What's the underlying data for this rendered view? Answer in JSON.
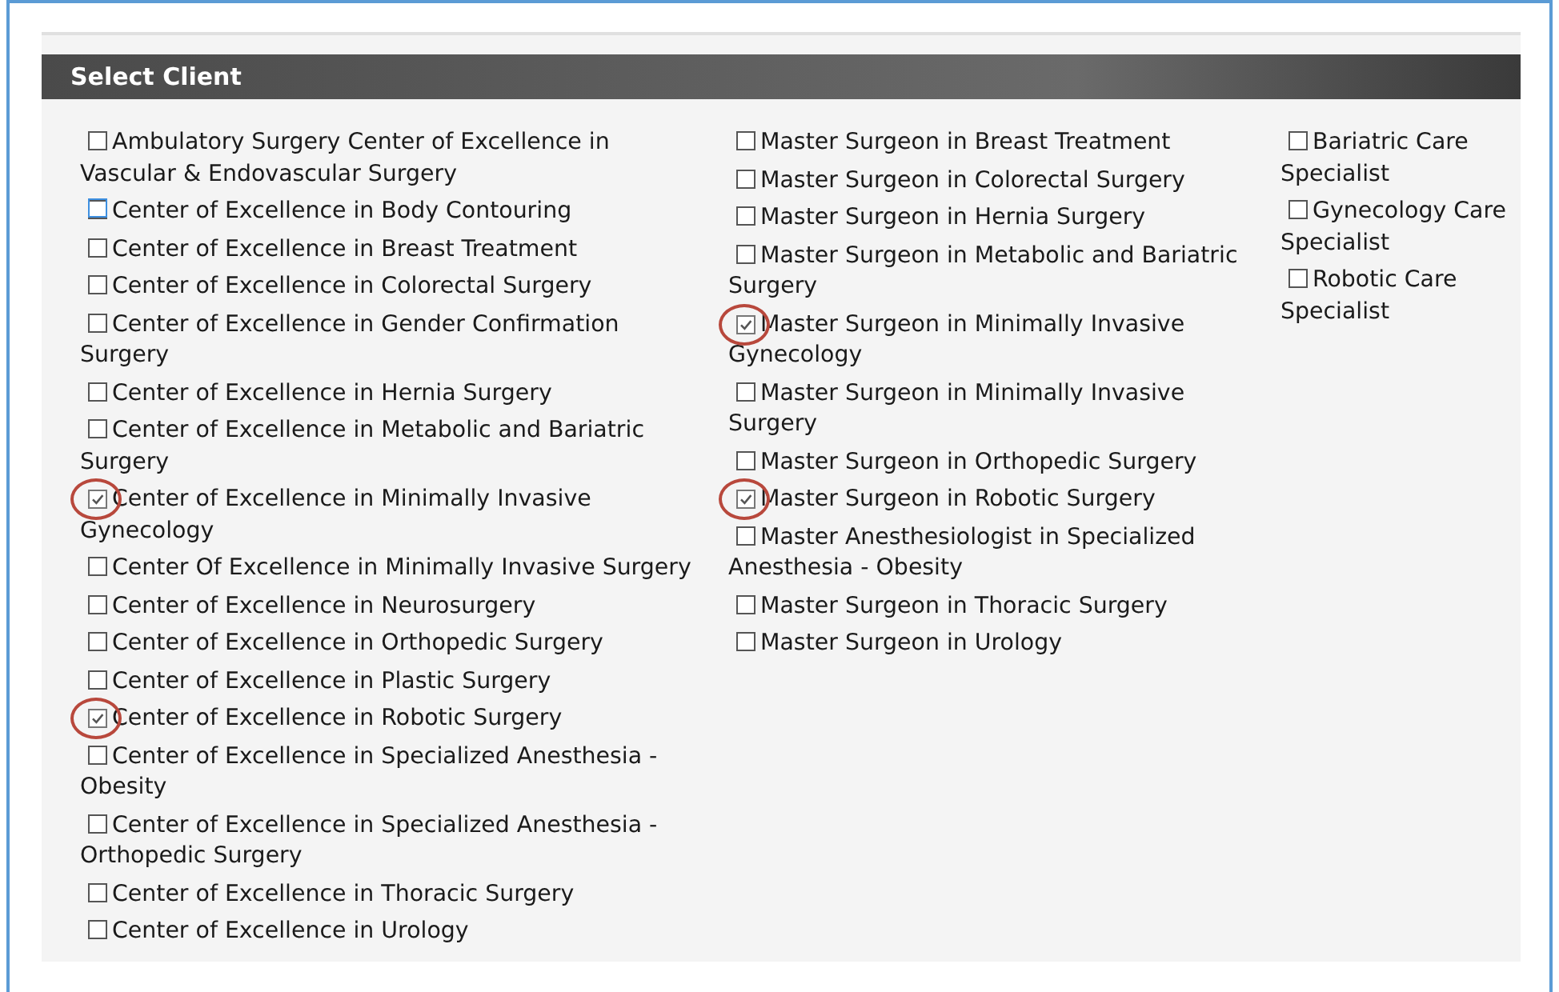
{
  "panel": {
    "title": "Select Client"
  },
  "columns": [
    {
      "items": [
        {
          "label": "Ambulatory Surgery Center of Excellence in Vascular & Endovascular Surgery",
          "checked": false,
          "focused": false,
          "circled": false
        },
        {
          "label": "Center of Excellence in Body Contouring",
          "checked": false,
          "focused": true,
          "circled": false
        },
        {
          "label": "Center of Excellence in Breast Treatment",
          "checked": false,
          "focused": false,
          "circled": false
        },
        {
          "label": "Center of Excellence in Colorectal Surgery",
          "checked": false,
          "focused": false,
          "circled": false
        },
        {
          "label": "Center of Excellence in Gender Confirmation Surgery",
          "checked": false,
          "focused": false,
          "circled": false
        },
        {
          "label": "Center of Excellence in Hernia Surgery",
          "checked": false,
          "focused": false,
          "circled": false
        },
        {
          "label": "Center of Excellence in Metabolic and Bariatric Surgery",
          "checked": false,
          "focused": false,
          "circled": false
        },
        {
          "label": "Center of Excellence in Minimally Invasive Gynecology",
          "checked": true,
          "focused": false,
          "circled": true
        },
        {
          "label": "Center Of Excellence in Minimally Invasive Surgery",
          "checked": false,
          "focused": false,
          "circled": false
        },
        {
          "label": "Center of Excellence in Neurosurgery",
          "checked": false,
          "focused": false,
          "circled": false
        },
        {
          "label": "Center of Excellence in Orthopedic Surgery",
          "checked": false,
          "focused": false,
          "circled": false
        },
        {
          "label": "Center of Excellence in Plastic Surgery",
          "checked": false,
          "focused": false,
          "circled": false
        },
        {
          "label": "Center of Excellence in Robotic Surgery",
          "checked": true,
          "focused": false,
          "circled": true
        },
        {
          "label": "Center of Excellence in Specialized Anesthesia - Obesity",
          "checked": false,
          "focused": false,
          "circled": false
        },
        {
          "label": "Center of Excellence in Specialized Anesthesia - Orthopedic Surgery",
          "checked": false,
          "focused": false,
          "circled": false
        },
        {
          "label": "Center of Excellence in Thoracic Surgery",
          "checked": false,
          "focused": false,
          "circled": false
        },
        {
          "label": "Center of Excellence in Urology",
          "checked": false,
          "focused": false,
          "circled": false
        }
      ]
    },
    {
      "items": [
        {
          "label": "Master Surgeon in Breast Treatment",
          "checked": false,
          "focused": false,
          "circled": false
        },
        {
          "label": "Master Surgeon in Colorectal Surgery",
          "checked": false,
          "focused": false,
          "circled": false
        },
        {
          "label": "Master Surgeon in Hernia Surgery",
          "checked": false,
          "focused": false,
          "circled": false
        },
        {
          "label": "Master Surgeon in Metabolic and Bariatric Surgery",
          "checked": false,
          "focused": false,
          "circled": false
        },
        {
          "label": "Master Surgeon in Minimally Invasive Gynecology",
          "checked": true,
          "focused": false,
          "circled": true
        },
        {
          "label": "Master Surgeon in Minimally Invasive Surgery",
          "checked": false,
          "focused": false,
          "circled": false
        },
        {
          "label": "Master Surgeon in Orthopedic Surgery",
          "checked": false,
          "focused": false,
          "circled": false
        },
        {
          "label": "Master Surgeon in Robotic Surgery",
          "checked": true,
          "focused": false,
          "circled": true
        },
        {
          "label": "Master Anesthesiologist in Specialized Anesthesia - Obesity",
          "checked": false,
          "focused": false,
          "circled": false
        },
        {
          "label": "Master Surgeon in Thoracic Surgery",
          "checked": false,
          "focused": false,
          "circled": false
        },
        {
          "label": "Master Surgeon in Urology",
          "checked": false,
          "focused": false,
          "circled": false
        }
      ]
    },
    {
      "items": [
        {
          "label": "Bariatric Care Specialist",
          "checked": false,
          "focused": false,
          "circled": false
        },
        {
          "label": "Gynecology Care Specialist",
          "checked": false,
          "focused": false,
          "circled": false
        },
        {
          "label": "Robotic Care Specialist",
          "checked": false,
          "focused": false,
          "circled": false
        }
      ]
    }
  ]
}
